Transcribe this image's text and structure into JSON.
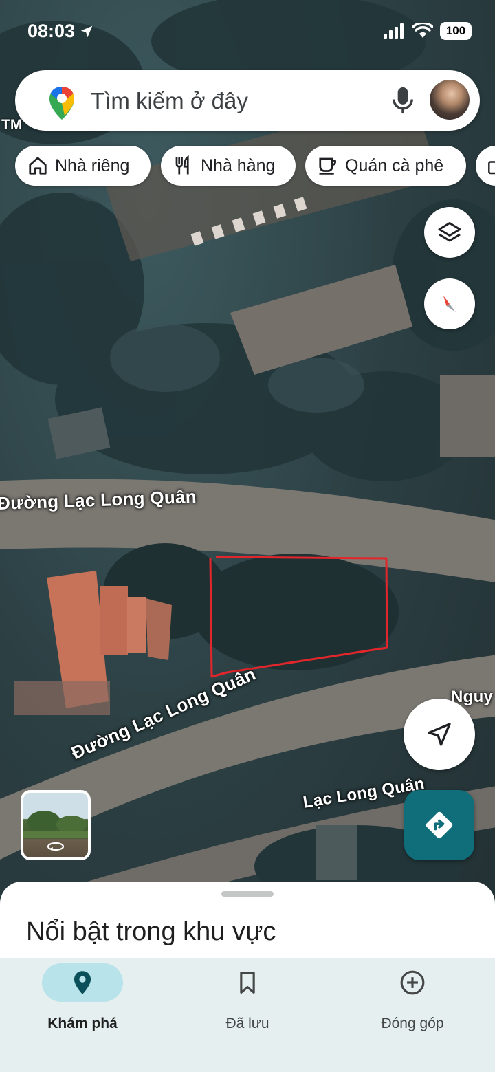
{
  "status_bar": {
    "time": "08:03",
    "battery": "100"
  },
  "search": {
    "placeholder": "Tìm kiếm ở đây"
  },
  "map": {
    "corner_label": "TM",
    "road_labels": [
      "Đường Lạc Long Quân",
      "Đường Lạc Long Quân",
      "Lạc Long Quân",
      "Nguy"
    ],
    "markup_color": "#e3262b"
  },
  "chips": [
    {
      "label": "Nhà riêng",
      "icon": "home-icon"
    },
    {
      "label": "Nhà hàng",
      "icon": "restaurant-icon"
    },
    {
      "label": "Quán cà phê",
      "icon": "coffee-icon"
    }
  ],
  "sheet": {
    "title": "Nổi bật trong khu vực"
  },
  "nav": [
    {
      "label": "Khám phá",
      "icon": "location-pin-icon",
      "active": true
    },
    {
      "label": "Đã lưu",
      "icon": "bookmark-icon",
      "active": false
    },
    {
      "label": "Đóng góp",
      "icon": "add-circle-icon",
      "active": false
    }
  ],
  "colors": {
    "accent": "#0f6e7a",
    "active_pill": "#b8e3ea",
    "nav_bg": "#e5eff0"
  }
}
